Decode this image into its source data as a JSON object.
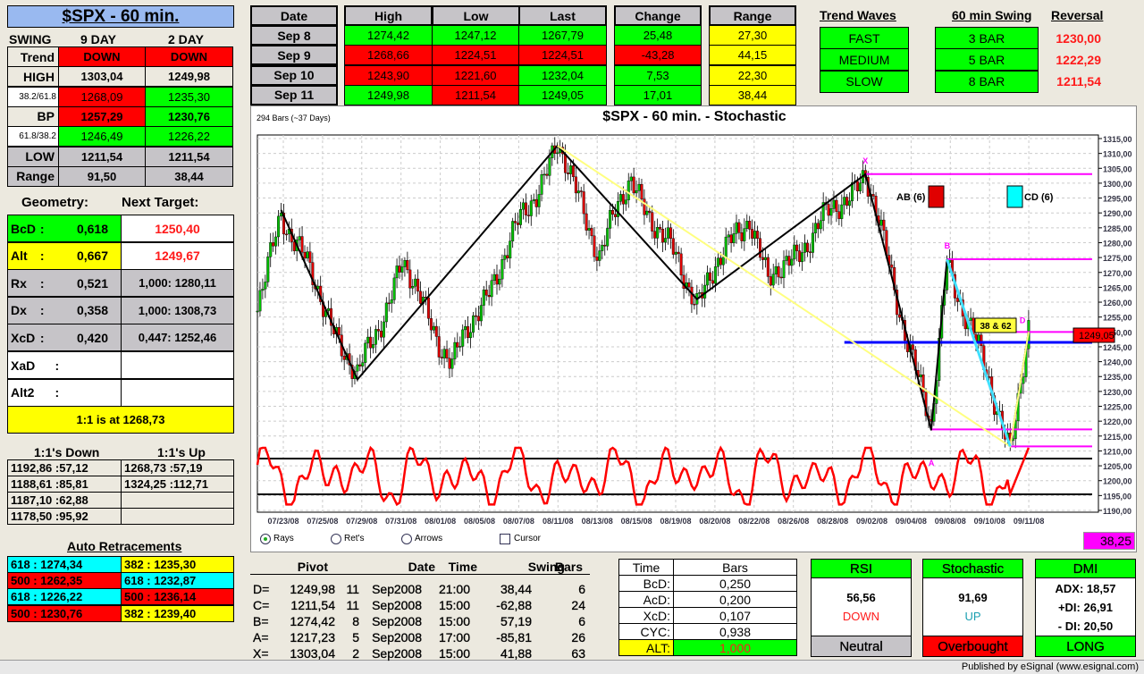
{
  "title": "$SPX - 60 min.",
  "swing": {
    "label": "SWING",
    "col9": "9 DAY",
    "col2": "2 DAY",
    "rows": [
      {
        "label": "Trend",
        "v9": "DOWN",
        "v2": "DOWN",
        "lc": "bg",
        "c9": "r",
        "c2": "r"
      },
      {
        "label": "HIGH",
        "v9": "1303,04",
        "v2": "1249,98",
        "lc": "bg",
        "c9": "bg",
        "c2": "bg"
      },
      {
        "label": "38.2/61.8",
        "v9": "1268,09",
        "v2": "1235,30",
        "lc": "w",
        "c9": "r",
        "c2": "g",
        "small": true
      },
      {
        "label": "BP",
        "v9": "1257,29",
        "v2": "1230,76",
        "lc": "bg",
        "c9": "r",
        "c2": "g"
      },
      {
        "label": "61.8/38.2",
        "v9": "1246,49",
        "v2": "1226,22",
        "lc": "w",
        "c9": "g",
        "c2": "g",
        "small": true
      },
      {
        "label": "LOW",
        "v9": "1211,54",
        "v2": "1211,54",
        "lc": "gr",
        "c9": "gr",
        "c2": "gr"
      },
      {
        "label": "Range",
        "v9": "91,50",
        "v2": "38,44",
        "lc": "gr",
        "c9": "gr",
        "c2": "gr"
      }
    ]
  },
  "geometry": {
    "label": "Geometry:",
    "target_label": "Next Target:",
    "rows": [
      {
        "name": "BcD",
        "val": "0,618",
        "target": "1250,40",
        "c": "g",
        "tc": "w",
        "red": true
      },
      {
        "name": "Alt",
        "val": "0,667",
        "target": "1249,67",
        "c": "y",
        "tc": "w",
        "red": true
      },
      {
        "name": "Rx",
        "val": "0,521",
        "target": "1,000: 1280,11",
        "c": "gr",
        "tc": "gr"
      },
      {
        "name": "Dx",
        "val": "0,358",
        "target": "1,000: 1308,73",
        "c": "gr",
        "tc": "gr"
      },
      {
        "name": "XcD",
        "val": "0,420",
        "target": "0,447: 1252,46",
        "c": "gr",
        "tc": "gr"
      },
      {
        "name": "XaD",
        "val": "",
        "target": "",
        "c": "w",
        "tc": "w"
      },
      {
        "name": "Alt2",
        "val": "",
        "target": "",
        "c": "w",
        "tc": "w"
      }
    ],
    "one_to_one": "1:1 is at 1268,73"
  },
  "ones": {
    "down_label": "1:1's Down",
    "up_label": "1:1's Up",
    "down": [
      "1192,86 :57,12",
      "1188,61 :85,81",
      "1187,10 :62,88",
      "1178,50 :95,92"
    ],
    "up": [
      "1268,73 :57,19",
      "1324,25 :112,71",
      "",
      ""
    ]
  },
  "retracements": {
    "label": "Auto Retracements",
    "rows": [
      {
        "a": "618 : 1274,34",
        "ac": "cy",
        "b": "382 : 1235,30",
        "bc": "y"
      },
      {
        "a": "500 : 1262,35",
        "ac": "r",
        "b": "618 : 1232,87",
        "bc": "cy"
      },
      {
        "a": "618 : 1226,22",
        "ac": "cy",
        "b": "500 : 1236,14",
        "bc": "r"
      },
      {
        "a": "500 : 1230,76",
        "ac": "r",
        "b": "382 : 1239,40",
        "bc": "y"
      }
    ]
  },
  "daily": {
    "headers": {
      "date": "Date",
      "high": "High",
      "low": "Low",
      "last": "Last",
      "change": "Change",
      "range": "Range"
    },
    "rows": [
      {
        "date": "Sep  8",
        "high": "1274,42",
        "low": "1247,12",
        "last": "1267,79",
        "change": "25,48",
        "range": "27,30",
        "hc": "g",
        "lc": "g",
        "lac": "g",
        "cc": "g"
      },
      {
        "date": "Sep  9",
        "high": "1268,66",
        "low": "1224,51",
        "last": "1224,51",
        "change": "-43,28",
        "range": "44,15",
        "hc": "r",
        "lc": "r",
        "lac": "r",
        "cc": "r"
      },
      {
        "date": "Sep  10",
        "high": "1243,90",
        "low": "1221,60",
        "last": "1232,04",
        "change": "7,53",
        "range": "22,30",
        "hc": "r",
        "lc": "r",
        "lac": "g",
        "cc": "g"
      },
      {
        "date": "Sep  11",
        "high": "1249,98",
        "low": "1211,54",
        "last": "1249,05",
        "change": "17,01",
        "range": "38,44",
        "hc": "g",
        "lc": "r",
        "lac": "g",
        "cc": "g"
      }
    ]
  },
  "trend": {
    "waves_label": "Trend Waves",
    "swing_label": "60 min Swing",
    "reversal_label": "Reversal",
    "waves": [
      "FAST",
      "MEDIUM",
      "SLOW"
    ],
    "swings": [
      "3 BAR",
      "5 BAR",
      "8 BAR"
    ],
    "reversals": [
      "1230,00",
      "1222,29",
      "1211,54"
    ]
  },
  "chart": {
    "bars_info": "294 Bars (~37 Days)",
    "title": "$SPX - 60 min. - Stochastic",
    "price_ticks": [
      "1315,00",
      "1310,00",
      "1305,00",
      "1300,00",
      "1295,00",
      "1290,00",
      "1285,00",
      "1280,00",
      "1275,00",
      "1270,00",
      "1265,00",
      "1260,00",
      "1255,00",
      "1250,00",
      "1245,00",
      "1240,00",
      "1235,00",
      "1230,00",
      "1225,00",
      "1220,00",
      "1215,00",
      "1210,00",
      "1205,00",
      "1200,00",
      "1195,00",
      "1190,00"
    ],
    "date_ticks": [
      "07/23/08",
      "07/25/08",
      "07/29/08",
      "07/31/08",
      "08/01/08",
      "08/05/08",
      "08/07/08",
      "08/11/08",
      "08/13/08",
      "08/15/08",
      "08/19/08",
      "08/20/08",
      "08/22/08",
      "08/26/08",
      "08/28/08",
      "09/02/08",
      "09/04/08",
      "09/08/08",
      "09/10/08",
      "09/11/08"
    ],
    "last_price": "1249,05",
    "stoch_value": "38,25",
    "labels": {
      "x": "X",
      "a": "A",
      "b": "B",
      "d": "D",
      "ratio": "38 & 62",
      "ab": "AB (6)",
      "cd": "CD (6)"
    },
    "options": [
      {
        "label": "Rays",
        "selected": true
      },
      {
        "label": "Ret's",
        "selected": false
      },
      {
        "label": "Arrows",
        "selected": false
      }
    ],
    "cursor_label": "Cursor",
    "colors": {
      "up": "#00c000",
      "down": "#e00000",
      "zigzag": "#000000",
      "xd": "#ffff80",
      "bc": "#40e0ff",
      "fib": "#ff00ff",
      "level": "#0000ff",
      "stoch": "#ff0000"
    }
  },
  "chart_data": {
    "type": "candlestick",
    "bars": 294,
    "ylim": [
      1190,
      1315
    ],
    "price_path": [
      [
        0,
        1257
      ],
      [
        9,
        1291
      ],
      [
        38,
        1234
      ],
      [
        55,
        1273
      ],
      [
        74,
        1239
      ],
      [
        114,
        1312.6
      ],
      [
        130,
        1277
      ],
      [
        142,
        1301
      ],
      [
        167,
        1261
      ],
      [
        187,
        1290
      ],
      [
        194,
        1266
      ],
      [
        231,
        1303
      ],
      [
        256,
        1217
      ],
      [
        262,
        1274.4
      ],
      [
        286,
        1211.5
      ],
      [
        293,
        1250
      ]
    ],
    "zigzag": [
      [
        9,
        1291
      ],
      [
        38,
        1234
      ],
      [
        114,
        1312.6
      ],
      [
        167,
        1261
      ],
      [
        231,
        1303
      ],
      [
        256,
        1217
      ],
      [
        262,
        1274.4
      ],
      [
        286,
        1211.5
      ],
      [
        293,
        1250
      ]
    ],
    "fib_levels": [
      1303.04,
      1274.42,
      1249.98,
      1217.23,
      1211.54
    ],
    "blue_level": 1246.5,
    "stoch_bands": [
      20,
      80
    ]
  },
  "pivots": {
    "headers": {
      "pivot": "Pivot",
      "date": "Date",
      "time": "Time",
      "swing": "Swing",
      "bars": "Bars"
    },
    "rows": [
      {
        "p": "D=",
        "v": "1249,98",
        "d": "11",
        "m": "Sep",
        "y": "2008",
        "t": "21:00",
        "s": "38,44",
        "b": "6"
      },
      {
        "p": "C=",
        "v": "1211,54",
        "d": "11",
        "m": "Sep",
        "y": "2008",
        "t": "15:00",
        "s": "-62,88",
        "b": "24"
      },
      {
        "p": "B=",
        "v": "1274,42",
        "d": "8",
        "m": "Sep",
        "y": "2008",
        "t": "15:00",
        "s": "57,19",
        "b": "6"
      },
      {
        "p": "A=",
        "v": "1217,23",
        "d": "5",
        "m": "Sep",
        "y": "2008",
        "t": "17:00",
        "s": "-85,81",
        "b": "26"
      },
      {
        "p": "X=",
        "v": "1303,04",
        "d": "2",
        "m": "Sep",
        "y": "2008",
        "t": "15:00",
        "s": "41,88",
        "b": "63"
      }
    ]
  },
  "timebars": {
    "h1": "Time",
    "h2": "Bars",
    "rows": [
      [
        "BcD:",
        "0,250"
      ],
      [
        "AcD:",
        "0,200"
      ],
      [
        "XcD:",
        "0,107"
      ],
      [
        "CYC:",
        "0,938"
      ]
    ],
    "alt": [
      "ALT:",
      "1,000"
    ]
  },
  "rsi": {
    "title": "RSI",
    "value": "56,56",
    "dir": "DOWN",
    "status": "Neutral"
  },
  "stoch": {
    "title": "Stochastic",
    "value": "91,69",
    "dir": "UP",
    "status": "Overbought"
  },
  "dmi": {
    "title": "DMI",
    "adx": "ADX:  18,57",
    "pdi": "+DI:  26,91",
    "mdi": "- DI:  20,50",
    "status": "LONG"
  },
  "footer": "Published by eSignal (www.esignal.com)"
}
